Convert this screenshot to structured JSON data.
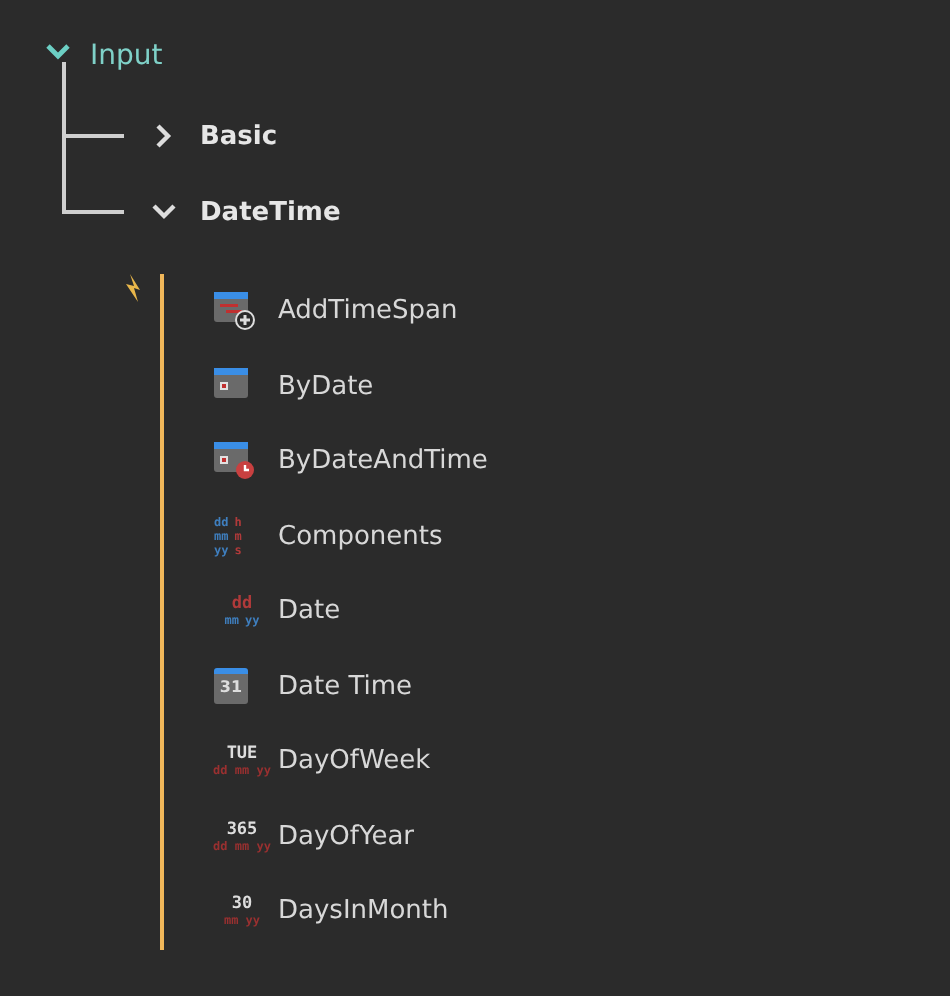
{
  "tree": {
    "label": "Input",
    "expanded": true,
    "children": [
      {
        "label": "Basic",
        "expanded": false
      },
      {
        "label": "DateTime",
        "expanded": true,
        "children": [
          {
            "label": "AddTimeSpan",
            "kind": "calendar-add"
          },
          {
            "label": "ByDate",
            "kind": "calendar"
          },
          {
            "label": "ByDateAndTime",
            "kind": "calendar-clock"
          },
          {
            "label": "Components",
            "kind": "text",
            "icon_rows": [
              [
                {
                  "text": "dd",
                  "color": "#3f7fbf"
                },
                {
                  "text": "h",
                  "color": "#b03a3a"
                }
              ],
              [
                {
                  "text": "mm",
                  "color": "#3f7fbf"
                },
                {
                  "text": "m",
                  "color": "#b03a3a"
                }
              ],
              [
                {
                  "text": "yy",
                  "color": "#3f7fbf"
                },
                {
                  "text": "s",
                  "color": "#b03a3a"
                }
              ]
            ]
          },
          {
            "label": "Date",
            "kind": "text",
            "icon_rows": [
              [
                {
                  "text": "dd",
                  "color": "#b03a3a"
                }
              ],
              [
                {
                  "text": "mm",
                  "color": "#3f7fbf"
                },
                {
                  "text": "yy",
                  "color": "#3f7fbf"
                }
              ]
            ]
          },
          {
            "label": "Date Time",
            "kind": "calendar-number",
            "icon_rows": [
              [
                {
                  "text": "31",
                  "color": "#dddddd"
                }
              ]
            ]
          },
          {
            "label": "DayOfWeek",
            "kind": "text",
            "icon_rows": [
              [
                {
                  "text": "TUE",
                  "color": "#dddddd"
                }
              ],
              [
                {
                  "text": "dd mm yy",
                  "color": "#9a3030"
                }
              ]
            ]
          },
          {
            "label": "DayOfYear",
            "kind": "text",
            "icon_rows": [
              [
                {
                  "text": "365",
                  "color": "#dddddd"
                }
              ],
              [
                {
                  "text": "dd mm yy",
                  "color": "#9a3030"
                }
              ]
            ]
          },
          {
            "label": "DaysInMonth",
            "kind": "text",
            "icon_rows": [
              [
                {
                  "text": "30",
                  "color": "#dddddd"
                }
              ],
              [
                {
                  "text": "mm yy",
                  "color": "#9a3030"
                }
              ]
            ]
          }
        ]
      }
    ]
  }
}
